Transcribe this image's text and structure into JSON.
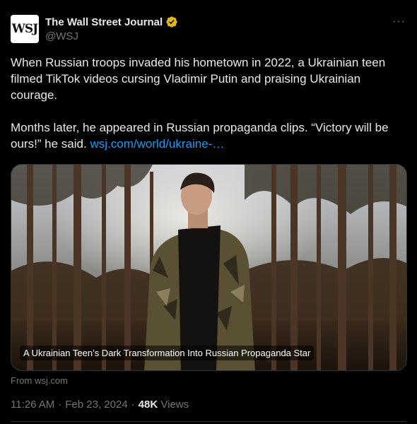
{
  "author": {
    "avatar_text": "WSJ",
    "display_name": "The Wall Street Journal",
    "handle": "@WSJ",
    "verified_badge_color": "#e2b719"
  },
  "menu": {
    "more_label": "···"
  },
  "tweet": {
    "paragraph1": "When Russian troops invaded his hometown in 2022, a Ukrainian teen filmed TikTok videos cursing Vladimir Putin and praising Ukrainian courage.",
    "paragraph2_text": "Months later, he appeared in Russian propaganda clips. “Victory will be ours!” he said.",
    "link_text": "wsj.com/world/ukraine-…"
  },
  "card": {
    "title": "A Ukrainian Teen’s Dark Transformation Into Russian Propaganda Star",
    "source": "From wsj.com",
    "image_icon": "photo-teen-forest"
  },
  "meta": {
    "time": "11:26 AM",
    "sep1": "·",
    "date": "Feb 23, 2024",
    "sep2": "·",
    "views_count": "48K",
    "views_label": "Views"
  },
  "colors": {
    "background": "#000000",
    "text": "#e7e9ea",
    "muted": "#71767b",
    "link": "#1d9bf0",
    "border": "#2f3336"
  }
}
